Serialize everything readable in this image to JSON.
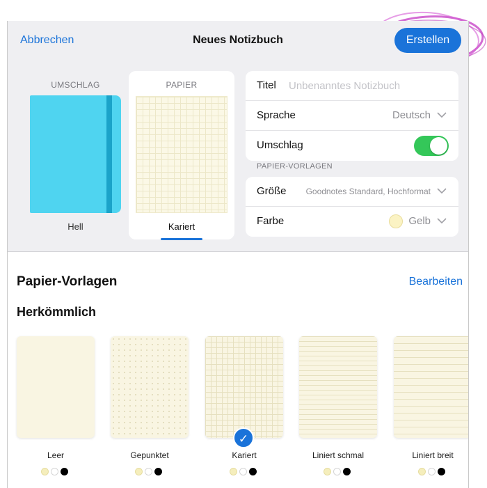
{
  "header": {
    "cancel_label": "Abbrechen",
    "title": "Neues Notizbuch",
    "create_label": "Erstellen"
  },
  "cover": {
    "section_label": "UMSCHLAG",
    "caption": "Hell",
    "color": "#4fd4f0",
    "band_color": "#1ba3c9"
  },
  "paper": {
    "section_label": "PAPIER",
    "caption": "Kariert"
  },
  "settings": {
    "title_label": "Titel",
    "title_placeholder": "Unbenanntes Notizbuch",
    "language_label": "Sprache",
    "language_value": "Deutsch",
    "cover_label": "Umschlag",
    "cover_toggle_on": true
  },
  "paper_templates_header": "PAPIER-VORLAGEN",
  "paper_settings": {
    "size_label": "Größe",
    "size_value": "Goodnotes Standard, Hochformat",
    "color_label": "Farbe",
    "color_value": "Gelb"
  },
  "templates_section": {
    "title": "Papier-Vorlagen",
    "edit_label": "Bearbeiten",
    "group_title": "Herkömmlich",
    "items": [
      {
        "label": "Leer"
      },
      {
        "label": "Gepunktet"
      },
      {
        "label": "Kariert",
        "selected": true
      },
      {
        "label": "Liniert schmal"
      },
      {
        "label": "Liniert breit"
      }
    ],
    "selected_check": "✓"
  },
  "colors": {
    "accent": "#1a73d9",
    "toggle_on": "#34c759",
    "annotation": "#c43bc4"
  }
}
